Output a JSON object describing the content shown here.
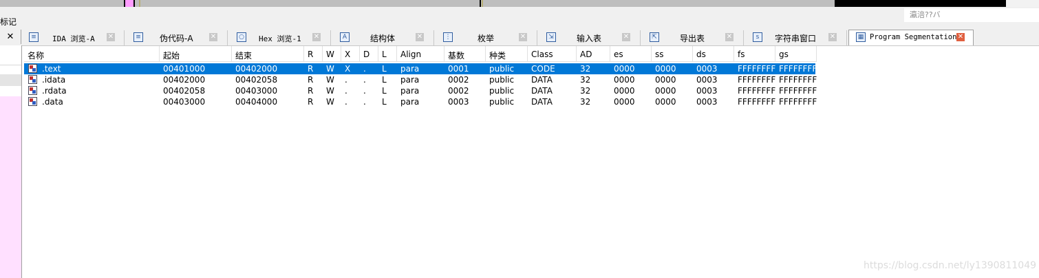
{
  "window": {
    "mark_label": "标记",
    "mini_input_text": "瀛涪??バ"
  },
  "colors": {
    "selection": "#0078d7",
    "nav_band": "#bebebe",
    "left_dock_highlight": "#ffe0ff",
    "active_tab_close": "#e06040"
  },
  "tabs": [
    {
      "label": "IDA 浏览-A",
      "icon": "ida-view-icon",
      "active": false
    },
    {
      "label": "伪代码-A",
      "icon": "pseudocode-icon",
      "active": false
    },
    {
      "label": "Hex 浏览-1",
      "icon": "hex-view-icon",
      "active": false
    },
    {
      "label": "结构体",
      "icon": "structures-icon",
      "active": false
    },
    {
      "label": "枚举",
      "icon": "enums-icon",
      "active": false
    },
    {
      "label": "输入表",
      "icon": "imports-icon",
      "active": false
    },
    {
      "label": "导出表",
      "icon": "exports-icon",
      "active": false
    },
    {
      "label": "字符串窗口",
      "icon": "strings-icon",
      "active": false
    },
    {
      "label": "Program Segmentation",
      "icon": "segments-icon",
      "active": true
    }
  ],
  "left_dock": {
    "close_label": "✕"
  },
  "table": {
    "columns": [
      "名称",
      "起始",
      "结束",
      "R",
      "W",
      "X",
      "D",
      "L",
      "Align",
      "基数",
      "种类",
      "Class",
      "AD",
      "es",
      "ss",
      "ds",
      "fs",
      "gs"
    ],
    "rows": [
      {
        "selected": true,
        "cells": [
          ".text",
          "00401000",
          "00402000",
          "R",
          "W",
          "X",
          ".",
          "L",
          "para",
          "0001",
          "public",
          "CODE",
          "32",
          "0000",
          "0000",
          "0003",
          "FFFFFFFF",
          "FFFFFFFF"
        ]
      },
      {
        "selected": false,
        "cells": [
          ".idata",
          "00402000",
          "00402058",
          "R",
          "W",
          ".",
          ".",
          "L",
          "para",
          "0002",
          "public",
          "DATA",
          "32",
          "0000",
          "0000",
          "0003",
          "FFFFFFFF",
          "FFFFFFFF"
        ]
      },
      {
        "selected": false,
        "cells": [
          ".rdata",
          "00402058",
          "00403000",
          "R",
          "W",
          ".",
          ".",
          "L",
          "para",
          "0002",
          "public",
          "DATA",
          "32",
          "0000",
          "0000",
          "0003",
          "FFFFFFFF",
          "FFFFFFFF"
        ]
      },
      {
        "selected": false,
        "cells": [
          ".data",
          "00403000",
          "00404000",
          "R",
          "W",
          ".",
          ".",
          "L",
          "para",
          "0003",
          "public",
          "DATA",
          "32",
          "0000",
          "0000",
          "0003",
          "FFFFFFFF",
          "FFFFFFFF"
        ]
      }
    ]
  },
  "watermark": "https://blog.csdn.net/ly1390811049"
}
